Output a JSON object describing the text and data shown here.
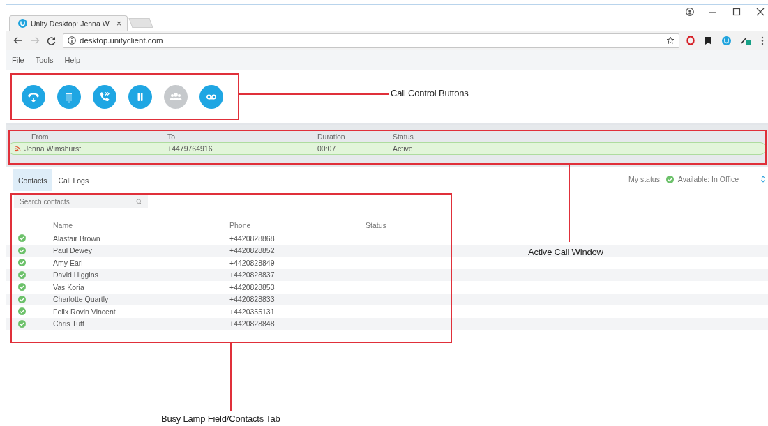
{
  "browser": {
    "tab_title": "Unity Desktop: Jenna W",
    "tab_close": "×",
    "url": "desktop.unityclient.com"
  },
  "menu": [
    "File",
    "Tools",
    "Help"
  ],
  "call_controls": [
    {
      "kind": "answer",
      "disabled": false
    },
    {
      "kind": "dialpad",
      "disabled": false
    },
    {
      "kind": "transfer",
      "disabled": false
    },
    {
      "kind": "hold",
      "disabled": false
    },
    {
      "kind": "conference",
      "disabled": true
    },
    {
      "kind": "voicemail",
      "disabled": false
    }
  ],
  "active_calls": {
    "columns": [
      "From",
      "To",
      "Duration",
      "Status"
    ],
    "rows": [
      {
        "from": "Jenna Wimshurst",
        "to": "+4479764916",
        "duration": "00:07",
        "status": "Active"
      }
    ]
  },
  "tabs": [
    {
      "label": "Contacts",
      "selected": true
    },
    {
      "label": "Call Logs",
      "selected": false
    }
  ],
  "my_status": {
    "label": "My status:",
    "value": "Available: In Office"
  },
  "contacts": {
    "search": {
      "placeholder": "Search contacts"
    },
    "columns": [
      "Name",
      "Phone",
      "Status"
    ],
    "rows": [
      {
        "name": "Alastair Brown",
        "phone": "+4420828868",
        "color": "#6cc16a"
      },
      {
        "name": "Paul Dewey",
        "phone": "+4420828852",
        "color": "#6cc16a"
      },
      {
        "name": "Amy Earl",
        "phone": "+4420828849",
        "color": "#6cc16a"
      },
      {
        "name": "David Higgins",
        "phone": "+4420828837",
        "color": "#6cc16a"
      },
      {
        "name": "Vas Koria",
        "phone": "+4420828853",
        "color": "#6cc16a"
      },
      {
        "name": "Charlotte Quartly",
        "phone": "+4420828833",
        "color": "#6cc16a"
      },
      {
        "name": "Felix Rovin Vincent",
        "phone": "+4420355131",
        "color": "#6cc16a"
      },
      {
        "name": "Chris Tutt",
        "phone": "+4420828848",
        "color": "#6cc16a"
      }
    ]
  },
  "annotations": [
    {
      "label": "Call Control Buttons"
    },
    {
      "label": "Active Call Window"
    },
    {
      "label": "Busy Lamp Field/Contacts Tab"
    }
  ]
}
